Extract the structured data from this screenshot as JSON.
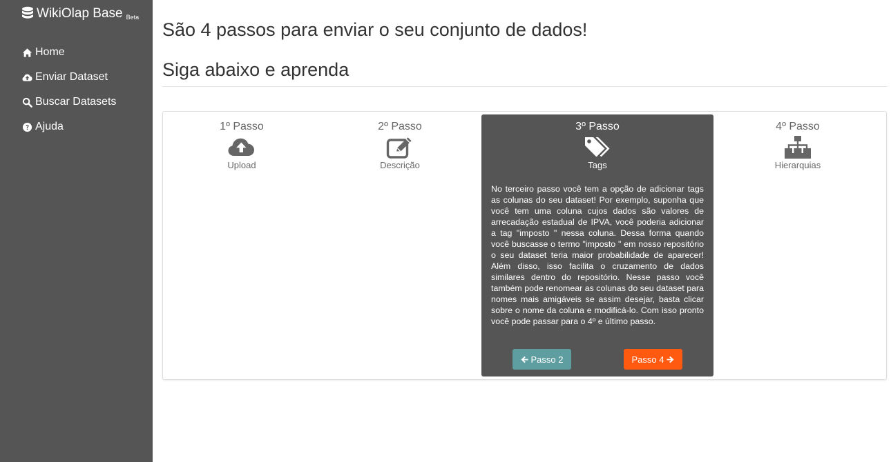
{
  "app": {
    "name": "WikiOlap Base",
    "badge": "Beta"
  },
  "sidebar": {
    "items": [
      {
        "label": "Home",
        "icon": "home-icon"
      },
      {
        "label": "Enviar Dataset",
        "icon": "cloud-upload-icon"
      },
      {
        "label": "Buscar Datasets",
        "icon": "search-icon"
      },
      {
        "label": "Ajuda",
        "icon": "question-circle-icon"
      }
    ]
  },
  "main": {
    "heading": "São 4 passos para enviar o seu conjunto de dados!",
    "subheading": "Siga abaixo e aprenda"
  },
  "steps": [
    {
      "title": "1º Passo",
      "label": "Upload",
      "icon": "cloud-upload-icon"
    },
    {
      "title": "2º Passo",
      "label": "Descrição",
      "icon": "edit-icon"
    },
    {
      "title": "3º Passo",
      "label": "Tags",
      "icon": "tags-icon",
      "active": true
    },
    {
      "title": "4º Passo",
      "label": "Hierarquias",
      "icon": "sitemap-icon"
    }
  ],
  "active_step": {
    "text": "No terceiro passo você tem a opção de adicionar tags as colunas do seu dataset! Por exemplo, suponha que você tem uma coluna cujos dados são valores de arrecadação estadual de IPVA, você poderia adicionar a tag \"imposto \" nessa coluna. Dessa forma quando você buscasse o termo \"imposto \" em nosso repositório o seu dataset teria maior probabilidade de aparecer! Além disso, isso facilita o cruzamento de dados similares dentro do repositório. Nesse passo você também pode renomear as colunas do seu dataset para nomes mais amigáveis se assim desejar, basta clicar sobre o nome da coluna e modificá-lo. Com isso pronto você pode passar para o 4º e último passo.",
    "prev_label": "Passo 2",
    "next_label": "Passo 4"
  },
  "colors": {
    "sidebar_bg": "#555555",
    "active_card_bg": "#555555",
    "prev_button": "#5f9ea0",
    "next_button": "#ff5a10"
  }
}
